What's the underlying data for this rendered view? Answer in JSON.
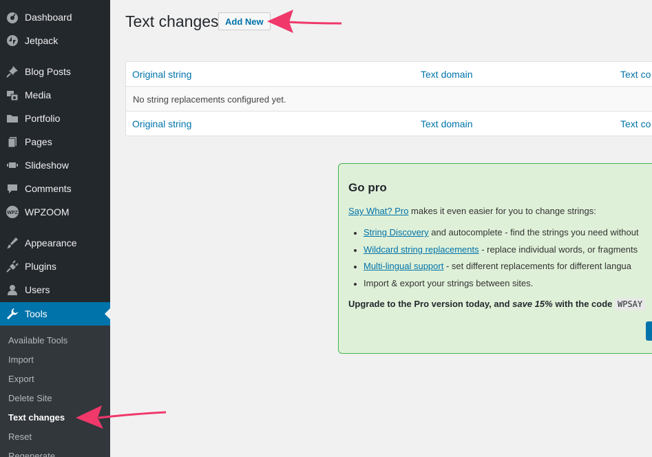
{
  "sidebar": {
    "items": [
      {
        "label": "Dashboard",
        "icon": "dashboard-icon"
      },
      {
        "label": "Jetpack",
        "icon": "jetpack-icon"
      },
      {
        "label": "Blog Posts",
        "icon": "pin-icon"
      },
      {
        "label": "Media",
        "icon": "media-icon"
      },
      {
        "label": "Portfolio",
        "icon": "folder-icon"
      },
      {
        "label": "Pages",
        "icon": "pages-icon"
      },
      {
        "label": "Slideshow",
        "icon": "slideshow-icon"
      },
      {
        "label": "Comments",
        "icon": "comment-icon"
      },
      {
        "label": "WPZOOM",
        "icon": "wpzoom-icon"
      },
      {
        "label": "Appearance",
        "icon": "brush-icon"
      },
      {
        "label": "Plugins",
        "icon": "plugin-icon"
      },
      {
        "label": "Users",
        "icon": "user-icon"
      },
      {
        "label": "Tools",
        "icon": "wrench-icon"
      }
    ],
    "submenu": [
      "Available Tools",
      "Import",
      "Export",
      "Delete Site",
      "Text changes",
      "Reset",
      "Regenerate"
    ]
  },
  "header": {
    "title": "Text changes",
    "add_new": "Add New"
  },
  "table": {
    "columns": [
      "Original string",
      "Text domain",
      "Text co"
    ],
    "empty_message": "No string replacements configured yet."
  },
  "pro": {
    "title": "Go pro",
    "intro_link": "Say What? Pro",
    "intro_text": " makes it even easier for you to change strings:",
    "features": [
      {
        "link": "String Discovery",
        "text": " and autocomplete - find the strings you need without"
      },
      {
        "link": "Wildcard string replacements",
        "text": " - replace individual words, or fragments"
      },
      {
        "link": "Multi-lingual support",
        "text": " - set different replacements for different langua"
      },
      {
        "link": "",
        "text": "Import & export your strings between sites."
      }
    ],
    "upgrade_a": "Upgrade to the Pro version today, and ",
    "upgrade_em": "save 15%",
    "upgrade_b": " with the code ",
    "code": "WPSAY"
  },
  "colors": {
    "sidebar_bg": "#23282d",
    "active": "#0073aa",
    "link": "#0073aa",
    "pro_bg": "#dff0d8",
    "pro_border": "#46b450",
    "annotation_arrow": "#f0386b"
  }
}
